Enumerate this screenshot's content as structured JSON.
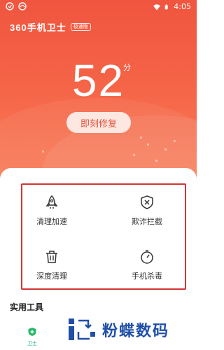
{
  "status_bar": {
    "time": "4:05",
    "left_icons": [
      "notification-icon",
      "shield-status-icon"
    ],
    "right_icons": [
      "wifi-icon",
      "battery-icon"
    ]
  },
  "header": {
    "app_name": "360手机卫士",
    "edition_badge": "极速版"
  },
  "score": {
    "value": "52",
    "unit": "分"
  },
  "fix_button": {
    "label": "即刻修复"
  },
  "features": [
    {
      "label": "清理加速",
      "icon": "rocket-icon"
    },
    {
      "label": "欺诈拦截",
      "icon": "shield-x-icon"
    },
    {
      "label": "深度清理",
      "icon": "trash-icon"
    },
    {
      "label": "手机杀毒",
      "icon": "virus-scan-icon"
    }
  ],
  "tools_section": {
    "title": "实用工具"
  },
  "bottom_tab": {
    "label": "卫士",
    "icon": "shield-plus-icon"
  },
  "watermark": {
    "text": "粉蝶数码"
  },
  "colors": {
    "accent": "#f0553f",
    "highlight_box": "#d33434",
    "tab_active": "#29b86a",
    "watermark": "#1f4fa8"
  }
}
